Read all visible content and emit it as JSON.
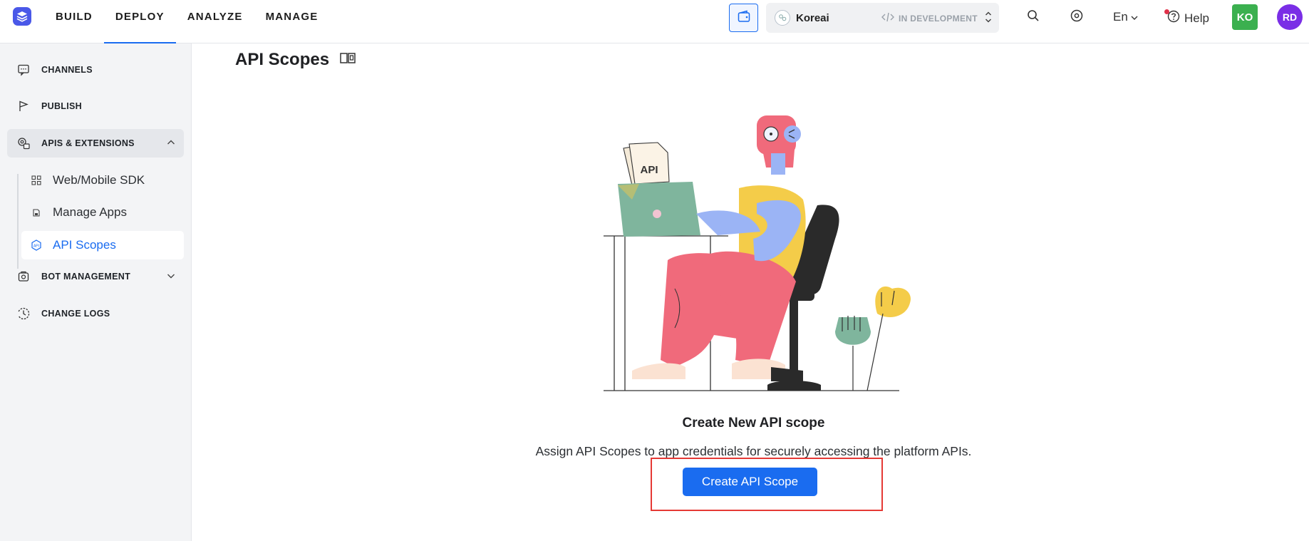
{
  "nav": {
    "items": [
      {
        "label": "BUILD",
        "active": false
      },
      {
        "label": "DEPLOY",
        "active": true
      },
      {
        "label": "ANALYZE",
        "active": false
      },
      {
        "label": "MANAGE",
        "active": false
      }
    ]
  },
  "header": {
    "app_name": "Koreai",
    "app_status": "IN DEVELOPMENT",
    "language": "En",
    "help_label": "Help",
    "user_initials_1": "KO",
    "user_initials_2": "RD"
  },
  "sidebar": {
    "items": [
      {
        "label": "CHANNELS",
        "icon": "chat-bubble-icon"
      },
      {
        "label": "PUBLISH",
        "icon": "flag-icon"
      },
      {
        "label": "APIS & EXTENSIONS",
        "icon": "api-gear-icon",
        "expanded": true
      },
      {
        "label": "BOT MANAGEMENT",
        "icon": "bot-icon",
        "expanded": false
      },
      {
        "label": "CHANGE LOGS",
        "icon": "clock-history-icon"
      }
    ],
    "sub_items": [
      {
        "label": "Web/Mobile SDK",
        "icon": "grid-icon",
        "active": false
      },
      {
        "label": "Manage Apps",
        "icon": "apps-icon",
        "active": false
      },
      {
        "label": "API Scopes",
        "icon": "api-scope-icon",
        "active": true
      }
    ]
  },
  "main": {
    "title": "API Scopes",
    "illustration_label": "API",
    "empty_title": "Create New API scope",
    "empty_description": "Assign API Scopes to app credentials for securely accessing the platform APIs.",
    "create_button": "Create API Scope"
  },
  "colors": {
    "accent": "#1a6cf0",
    "highlight": "#e53935",
    "ko_avatar": "#3bb04f",
    "rd_avatar": "#7a2ee6"
  }
}
